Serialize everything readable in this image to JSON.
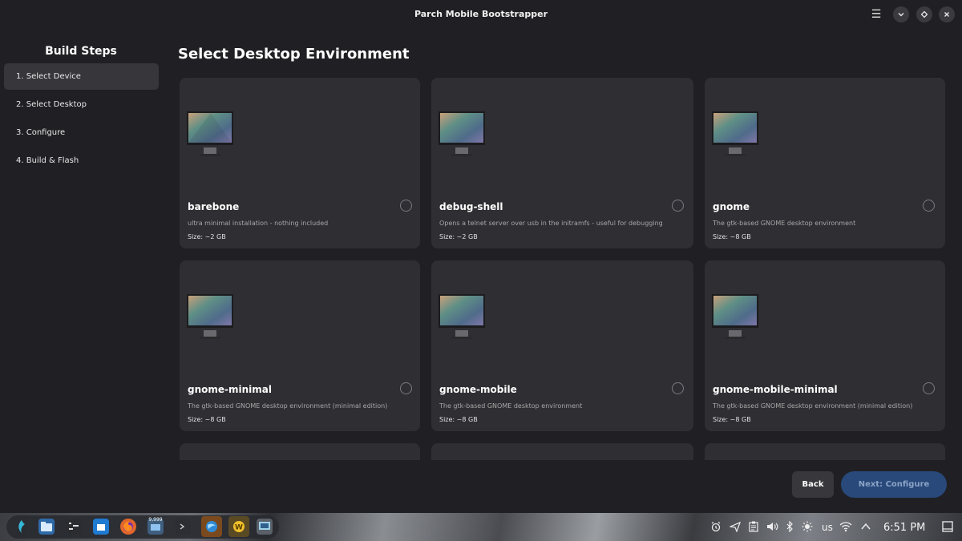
{
  "window": {
    "title": "Parch Mobile Bootstrapper",
    "icons": {
      "menu": "hamburger-menu-icon",
      "minimize": "chevron-down-icon",
      "maximize": "diamond-icon",
      "close": "close-icon"
    }
  },
  "sidebar": {
    "title": "Build Steps",
    "steps": [
      {
        "label": "1. Select Device",
        "active": true
      },
      {
        "label": "2. Select Desktop",
        "active": false
      },
      {
        "label": "3. Configure",
        "active": false
      },
      {
        "label": "4. Build & Flash",
        "active": false
      }
    ]
  },
  "main": {
    "heading": "Select Desktop Environment",
    "cards": [
      {
        "name": "barebone",
        "description": "ultra minimal installation - nothing included",
        "size": "Size: ~2 GB",
        "selected": false
      },
      {
        "name": "debug-shell",
        "description": "Opens a telnet server over usb in the initramfs - useful for debugging",
        "size": "Size: ~2 GB",
        "selected": false
      },
      {
        "name": "gnome",
        "description": "The gtk-based GNOME desktop environment",
        "size": "Size: ~8 GB",
        "selected": false
      },
      {
        "name": "gnome-minimal",
        "description": "The gtk-based GNOME desktop environment (minimal edition)",
        "size": "Size: ~8 GB",
        "selected": false
      },
      {
        "name": "gnome-mobile",
        "description": "The gtk-based GNOME desktop environment",
        "size": "Size: ~8 GB",
        "selected": false
      },
      {
        "name": "gnome-mobile-minimal",
        "description": "The gtk-based GNOME desktop environment (minimal edition)",
        "size": "Size: ~8 GB",
        "selected": false
      }
    ]
  },
  "footer": {
    "back_label": "Back",
    "next_label": "Next: Configure"
  },
  "taskbar": {
    "badge": "9,999",
    "keyboard_layout": "us",
    "clock": "6:51 PM"
  },
  "colors": {
    "accent": "#28497a",
    "background": "#202024",
    "card": "#2e2e33"
  }
}
